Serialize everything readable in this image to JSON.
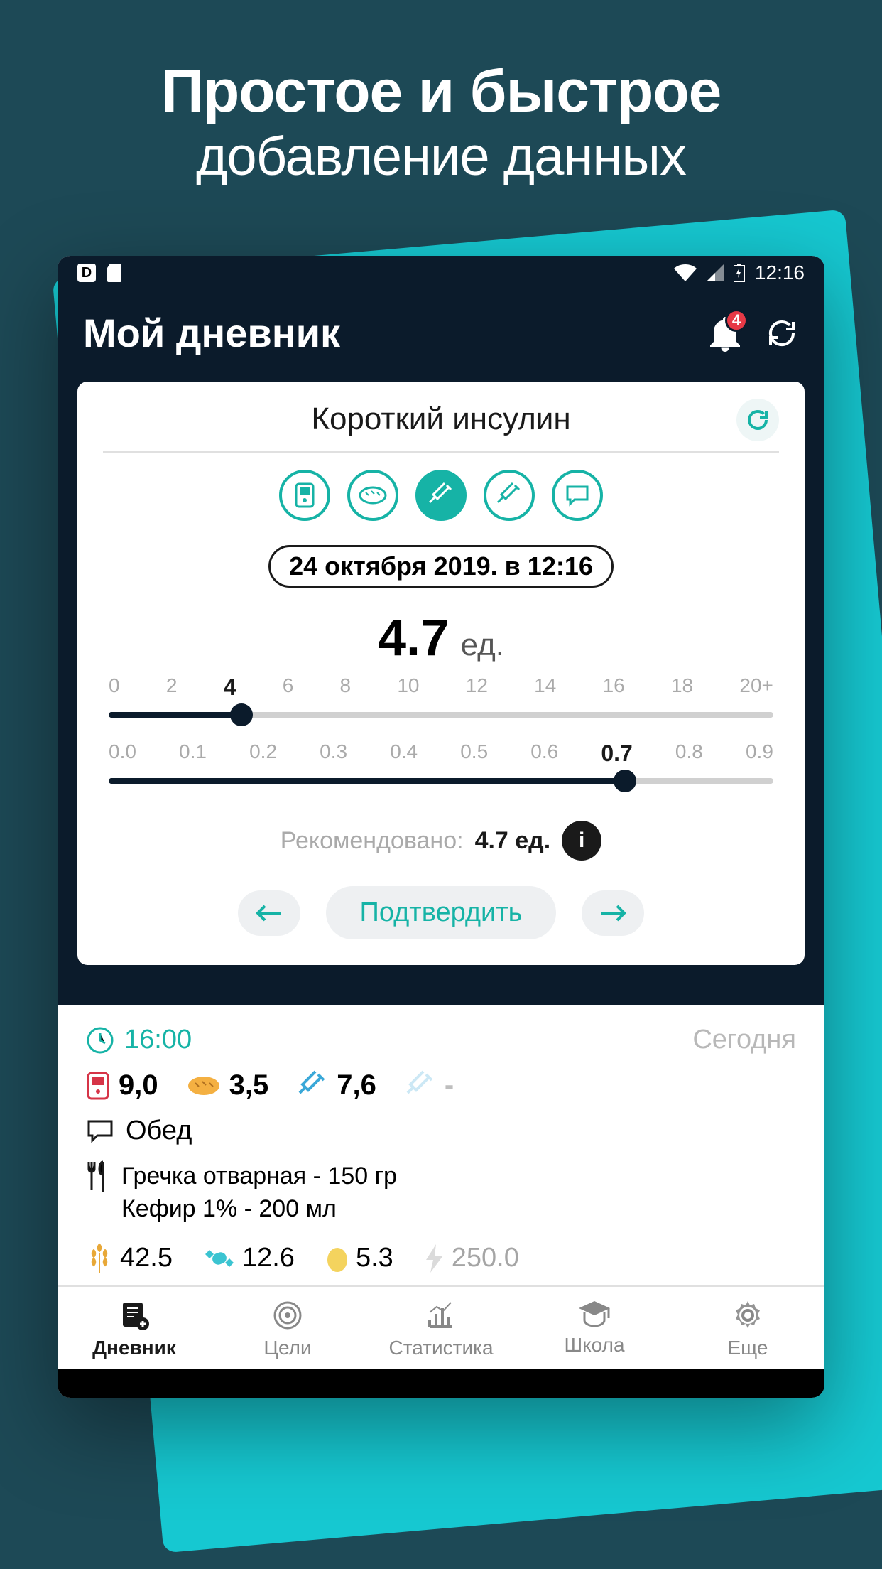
{
  "promo": {
    "line1": "Простое и быстрое",
    "line2": "добавление данных"
  },
  "status": {
    "time": "12:16"
  },
  "header": {
    "title": "Мой дневник",
    "badge": "4"
  },
  "card": {
    "title": "Короткий инсулин",
    "datetime": "24 октября 2019.  в  12:16",
    "value": "4.7",
    "unit": "ед.",
    "slider1": {
      "ticks": [
        "0",
        "2",
        "4",
        "6",
        "8",
        "10",
        "12",
        "14",
        "16",
        "18",
        "20+"
      ],
      "active": "4",
      "fill_pct": 20
    },
    "slider2": {
      "ticks": [
        "0.0",
        "0.1",
        "0.2",
        "0.3",
        "0.4",
        "0.5",
        "0.6",
        "0.7",
        "0.8",
        "0.9"
      ],
      "active": "0.7",
      "fill_pct": 77.7
    },
    "recommend_label": "Рекомендовано:",
    "recommend_value": "4.7 ед.",
    "confirm": "Подтвердить"
  },
  "log": {
    "time": "16:00",
    "day": "Сегодня",
    "metrics": {
      "glucose": "9,0",
      "bread": "3,5",
      "insulin_short": "7,6",
      "insulin_long": "-"
    },
    "meal": "Обед",
    "foods": [
      "Гречка отварная - 150 гр",
      "Кефир 1% - 200 мл"
    ],
    "nutri": {
      "carbs": "42.5",
      "protein": "12.6",
      "fat": "5.3",
      "energy": "250.0"
    }
  },
  "tabs": {
    "diary": "Дневник",
    "goals": "Цели",
    "stats": "Статистика",
    "school": "Школа",
    "more": "Еще"
  }
}
